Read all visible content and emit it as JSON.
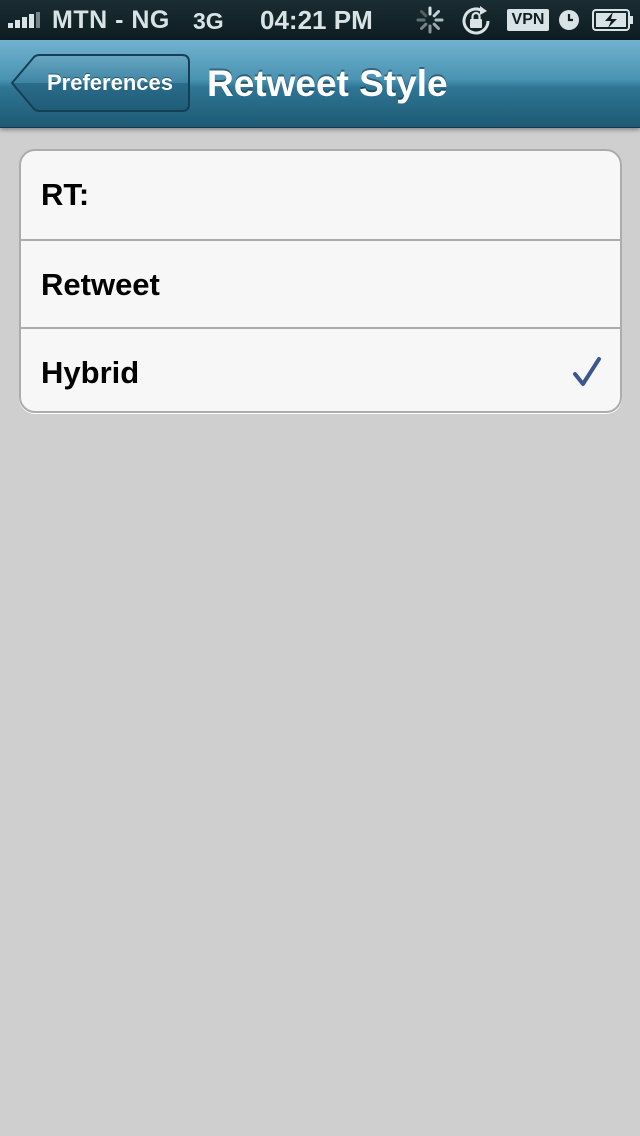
{
  "status_bar": {
    "carrier": "MTN - NG",
    "network": "3G",
    "time": "04:21 PM",
    "vpn_label": "VPN",
    "icons": [
      "signal-icon",
      "activity-spinner-icon",
      "rotation-lock-icon",
      "vpn-icon",
      "alarm-clock-icon",
      "battery-charging-icon"
    ]
  },
  "nav": {
    "back_label": "Preferences",
    "title": "Retweet Style"
  },
  "options": [
    {
      "label": "RT:",
      "selected": false
    },
    {
      "label": "Retweet",
      "selected": false
    },
    {
      "label": "Hybrid",
      "selected": true
    }
  ],
  "colors": {
    "nav_accent": "#2f7594",
    "checkmark": "#3a5790",
    "background": "#cfcfcf"
  }
}
